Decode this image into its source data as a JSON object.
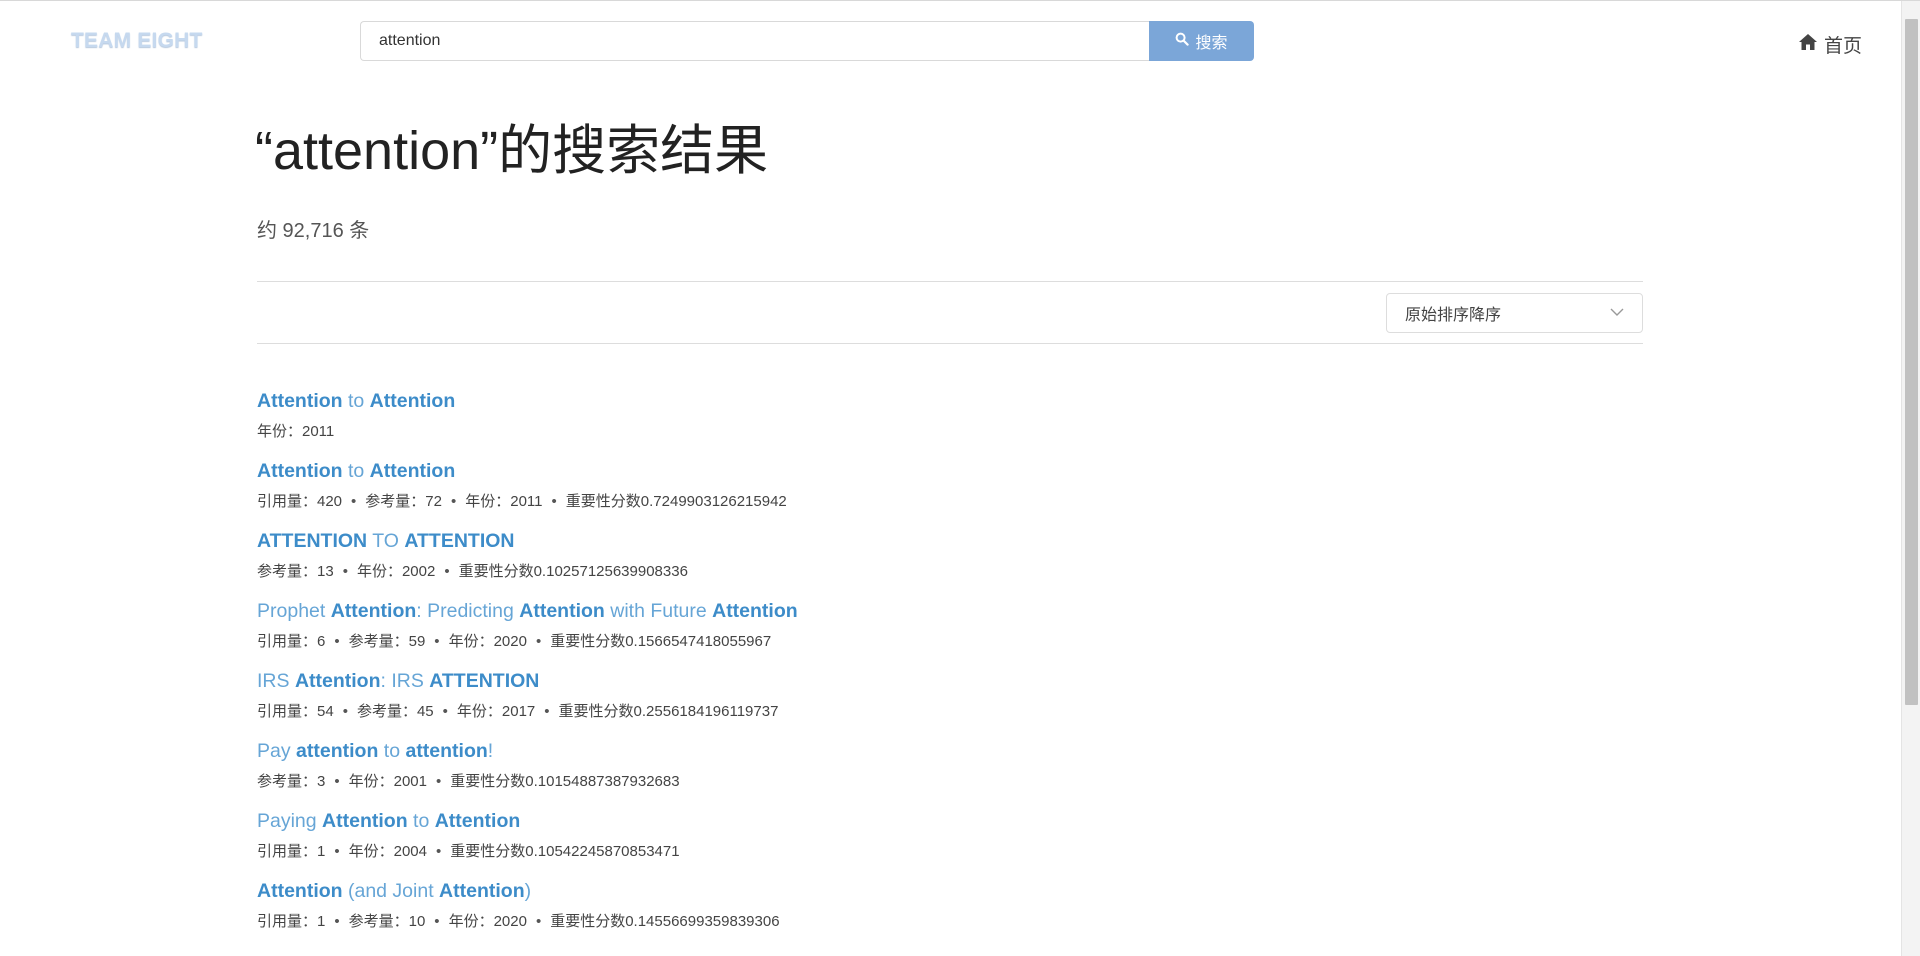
{
  "brand": {
    "logo": "TEAM EIGHT"
  },
  "search": {
    "value": "attention",
    "button_label": "搜索"
  },
  "nav": {
    "home_label": "首页"
  },
  "title": {
    "query": "attention",
    "suffix": "的搜索结果"
  },
  "count_text": "约 92,716 条",
  "sort": {
    "selected": "原始排序降序"
  },
  "colors": {
    "accent": "#7ba6d8",
    "link": "#66a5d6",
    "link_bold": "#3d8cc9"
  },
  "results": [
    {
      "title": [
        {
          "t": "Attention",
          "b": true
        },
        {
          "t": " to ",
          "b": false
        },
        {
          "t": "Attention",
          "b": true
        }
      ],
      "meta": [
        "年份：2011"
      ]
    },
    {
      "title": [
        {
          "t": "Attention",
          "b": true
        },
        {
          "t": " to ",
          "b": false
        },
        {
          "t": "Attention",
          "b": true
        }
      ],
      "meta": [
        "引用量：420",
        "参考量：72",
        "年份：2011",
        "重要性分数0.7249903126215942"
      ]
    },
    {
      "title": [
        {
          "t": "ATTENTION",
          "b": true
        },
        {
          "t": " TO ",
          "b": false
        },
        {
          "t": "ATTENTION",
          "b": true
        }
      ],
      "meta": [
        "参考量：13",
        "年份：2002",
        "重要性分数0.10257125639908336"
      ]
    },
    {
      "title": [
        {
          "t": "Prophet ",
          "b": false
        },
        {
          "t": "Attention",
          "b": true
        },
        {
          "t": ": Predicting ",
          "b": false
        },
        {
          "t": "Attention",
          "b": true
        },
        {
          "t": " with Future ",
          "b": false
        },
        {
          "t": "Attention",
          "b": true
        }
      ],
      "meta": [
        "引用量：6",
        "参考量：59",
        "年份：2020",
        "重要性分数0.1566547418055967"
      ]
    },
    {
      "title": [
        {
          "t": "IRS ",
          "b": false
        },
        {
          "t": "Attention",
          "b": true
        },
        {
          "t": ": IRS ",
          "b": false
        },
        {
          "t": "ATTENTION",
          "b": true
        }
      ],
      "meta": [
        "引用量：54",
        "参考量：45",
        "年份：2017",
        "重要性分数0.2556184196119737"
      ]
    },
    {
      "title": [
        {
          "t": "Pay ",
          "b": false
        },
        {
          "t": "attention",
          "b": true
        },
        {
          "t": " to ",
          "b": false
        },
        {
          "t": "attention",
          "b": true
        },
        {
          "t": "!",
          "b": false
        }
      ],
      "meta": [
        "参考量：3",
        "年份：2001",
        "重要性分数0.10154887387932683"
      ]
    },
    {
      "title": [
        {
          "t": "Paying ",
          "b": false
        },
        {
          "t": "Attention",
          "b": true
        },
        {
          "t": " to ",
          "b": false
        },
        {
          "t": "Attention",
          "b": true
        }
      ],
      "meta": [
        "引用量：1",
        "年份：2004",
        "重要性分数0.10542245870853471"
      ]
    },
    {
      "title": [
        {
          "t": "Attention",
          "b": true
        },
        {
          "t": " (and Joint ",
          "b": false
        },
        {
          "t": "Attention",
          "b": true
        },
        {
          "t": ")",
          "b": false
        }
      ],
      "meta": [
        "引用量：1",
        "参考量：10",
        "年份：2020",
        "重要性分数0.14556699359839306"
      ]
    }
  ]
}
